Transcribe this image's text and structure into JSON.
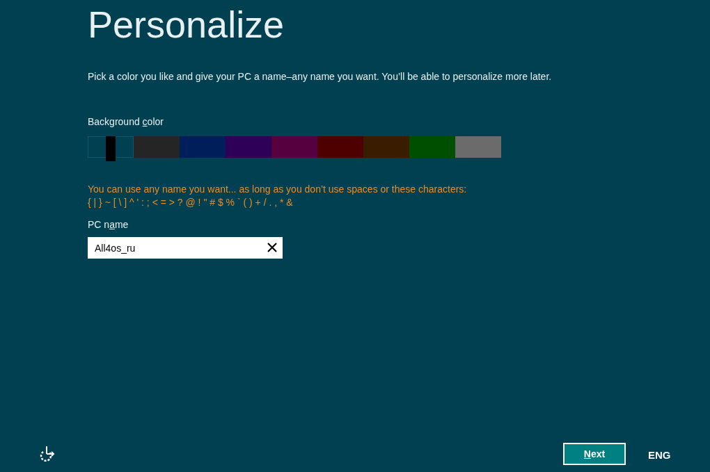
{
  "title": "Personalize",
  "intro": "Pick a color you like and give your PC a name–any name you want. You’ll be able to personalize more later.",
  "background_color": {
    "label": {
      "before": "Background ",
      "access_key": "c",
      "after": "olor"
    },
    "swatches": [
      {
        "color": "#004050",
        "selected": true
      },
      {
        "color": "#252525",
        "selected": false
      },
      {
        "color": "#001e5a",
        "selected": false
      },
      {
        "color": "#2e0058",
        "selected": false
      },
      {
        "color": "#560040",
        "selected": false
      },
      {
        "color": "#4e0000",
        "selected": false
      },
      {
        "color": "#3a1c00",
        "selected": false
      },
      {
        "color": "#004f00",
        "selected": false
      },
      {
        "color": "#6b6b6b",
        "selected": false
      }
    ]
  },
  "name_hint": [
    "You can use any name you want... as long as you don’t use spaces or these characters:",
    "{ | } ~ [ \\ ] ^ ' : ; < = > ? @ ! \" # $ % ` ( ) + / . , * &"
  ],
  "pc_name": {
    "label": {
      "before": "PC n",
      "access_key": "a",
      "after": "me"
    },
    "value": "All4os_ru"
  },
  "next_button": {
    "access_key": "N",
    "after": "ext"
  },
  "language": "ENG"
}
